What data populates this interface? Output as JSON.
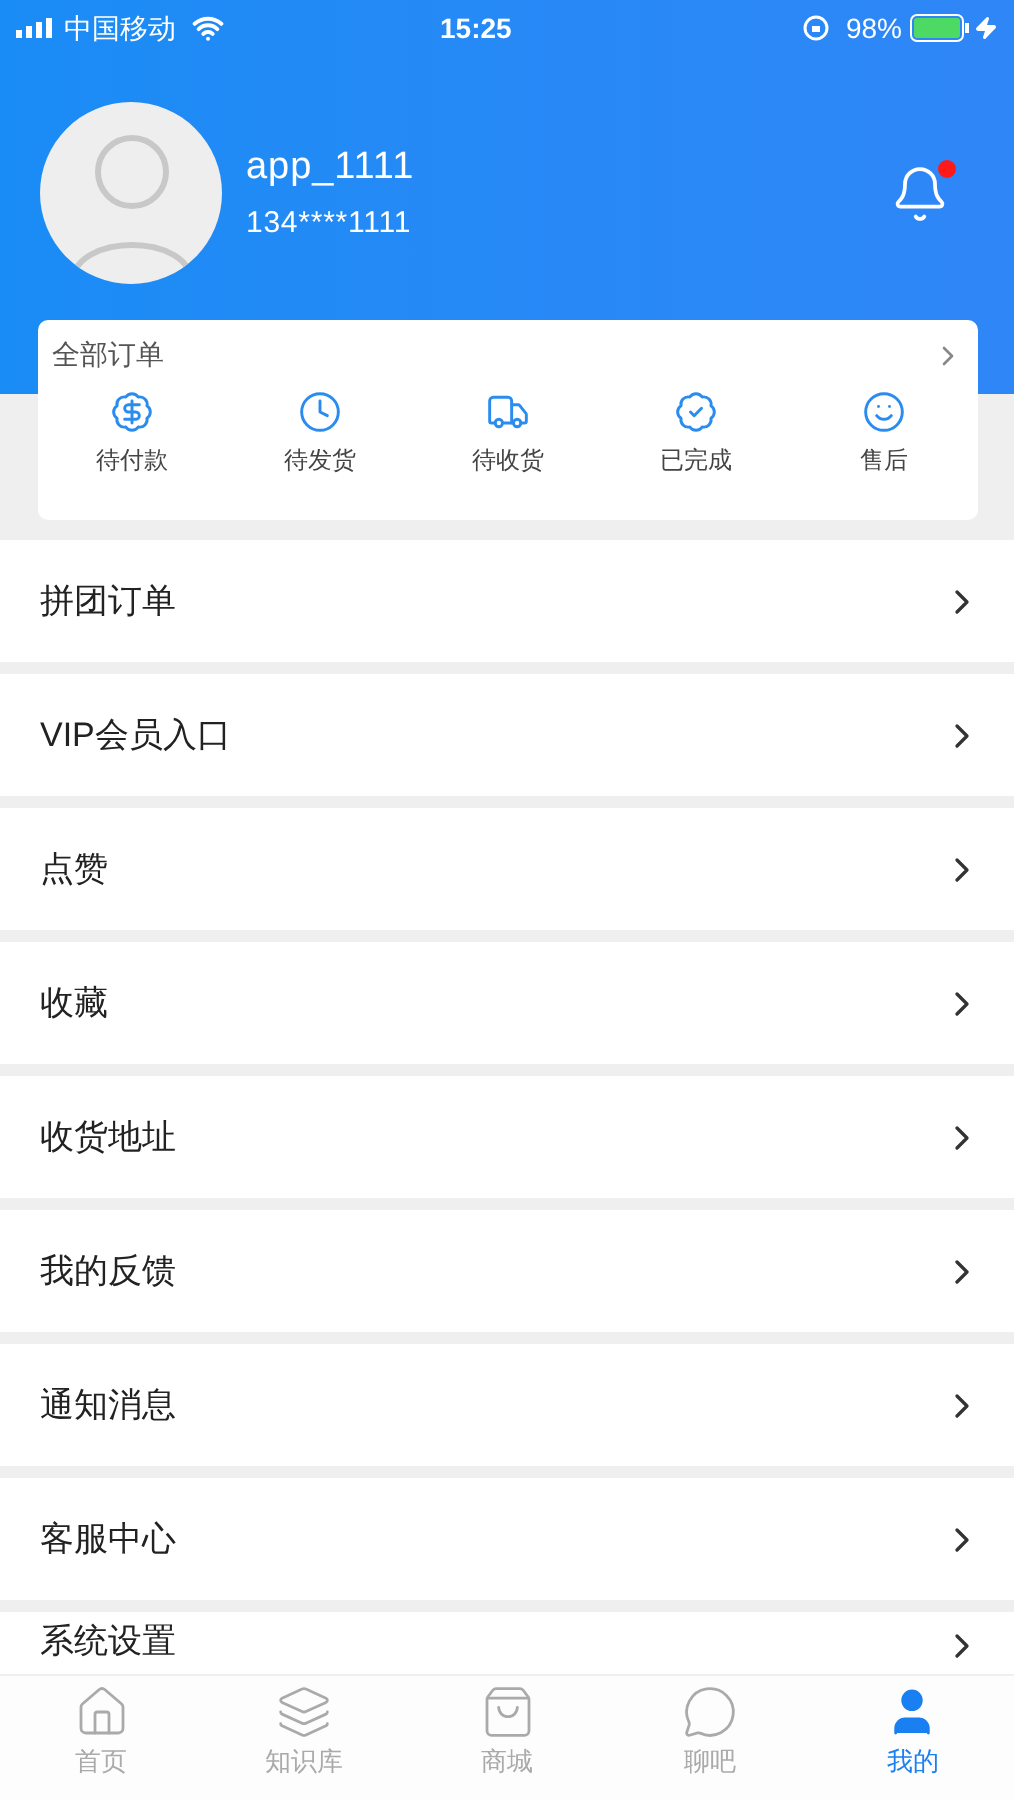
{
  "status_bar": {
    "carrier": "中国移动",
    "time": "15:25",
    "battery": "98%"
  },
  "profile": {
    "username": "app_1111",
    "phone": "134****1111",
    "notification_unread": true
  },
  "orders": {
    "title": "全部订单",
    "items": [
      {
        "kind": "payment",
        "label": "待付款"
      },
      {
        "kind": "shipping",
        "label": "待发货"
      },
      {
        "kind": "delivery",
        "label": "待收货"
      },
      {
        "kind": "done",
        "label": "已完成"
      },
      {
        "kind": "aftersale",
        "label": "售后"
      }
    ]
  },
  "menu": [
    "拼团订单",
    "VIP会员入口",
    "点赞",
    "收藏",
    "收货地址",
    "我的反馈",
    "通知消息",
    "客服中心",
    "系统设置"
  ],
  "tab_bar": [
    {
      "kind": "home",
      "label": "首页",
      "selected": false
    },
    {
      "kind": "layers",
      "label": "知识库",
      "selected": false
    },
    {
      "kind": "bag",
      "label": "商城",
      "selected": false
    },
    {
      "kind": "chat",
      "label": "聊吧",
      "selected": false
    },
    {
      "kind": "user",
      "label": "我的",
      "selected": true
    }
  ]
}
